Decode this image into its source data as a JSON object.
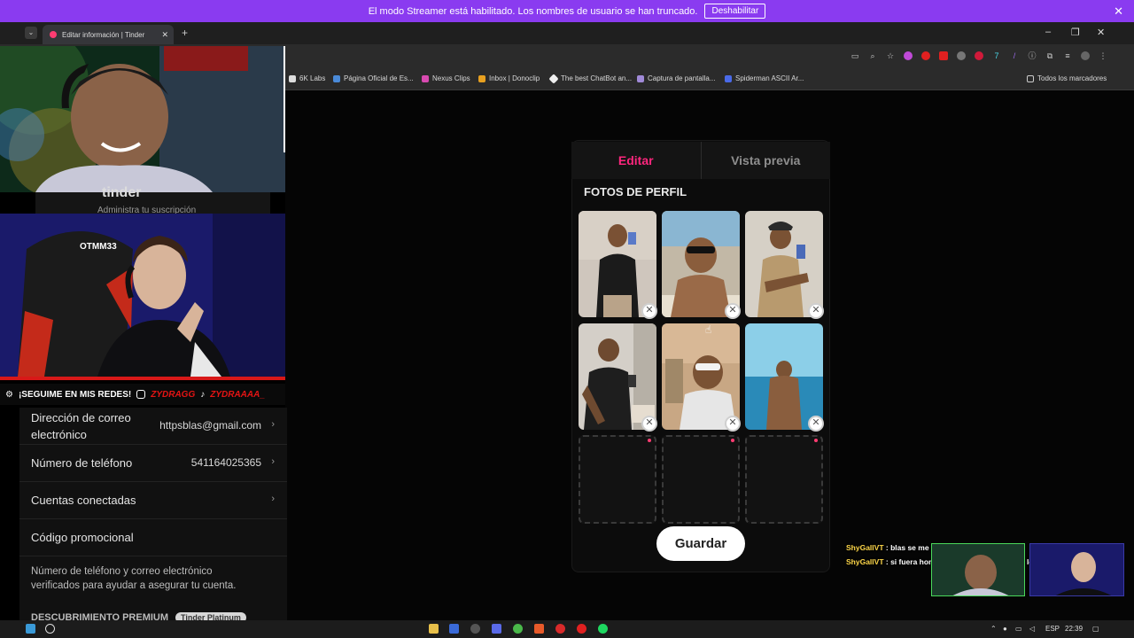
{
  "streamer_banner": {
    "text": "El modo Streamer está habilitado. Los nombres de usuario se han truncado.",
    "button": "Deshabilitar",
    "close": "✕"
  },
  "browser": {
    "tab_title": "Editar información | Tinder",
    "bookmarks": [
      "6K Labs",
      "Página Oficial de Es...",
      "Nexus Clips",
      "Inbox | Donoclip",
      "The best ChatBot an...",
      "Captura de pantalla...",
      "Spiderman ASCII Ar..."
    ],
    "all_bookmarks": "Todos los marcadores"
  },
  "editor": {
    "tab_edit": "Editar",
    "tab_preview": "Vista previa",
    "section_title": "FOTOS DE PERFIL",
    "save_button": "Guardar",
    "remove_symbol": "✕"
  },
  "settings": {
    "email_label": "Dirección de correo electrónico",
    "email_value": "httpsblas@gmail.com",
    "phone_label": "Número de teléfono",
    "phone_value": "541164025365",
    "connected_label": "Cuentas conectadas",
    "promo_label": "Código promocional",
    "note": "Número de teléfono y correo electrónico verificados para ayudar a asegurar tu cuenta.",
    "premium_label": "DESCUBRIMIENTO PREMIUM",
    "premium_badge": "Tinder Platinum"
  },
  "overlay": {
    "tinder_logo": "tinder",
    "tinder_sub": "Administra tu suscripción",
    "follow": "¡SEGUIME EN MIS REDES!",
    "instagram": "ZYDRAGG",
    "tiktok": "ZYDRAAAA_"
  },
  "chat": [
    {
      "user": "ShyGallVT",
      "sep": " : ",
      "msg": "blas se me paro boorra esas fotos ya"
    },
    {
      "user": "ShyGallVT",
      "sep": " : ",
      "msg": "si fuera hombre gay le re doy pero no lo dejo parar de la cama"
    }
  ],
  "taskbar": {
    "lang": "ESP",
    "time": "22:39"
  },
  "colors": {
    "streamer_banner": "#8a3bf0",
    "tinder_accent": "#fd267d"
  }
}
